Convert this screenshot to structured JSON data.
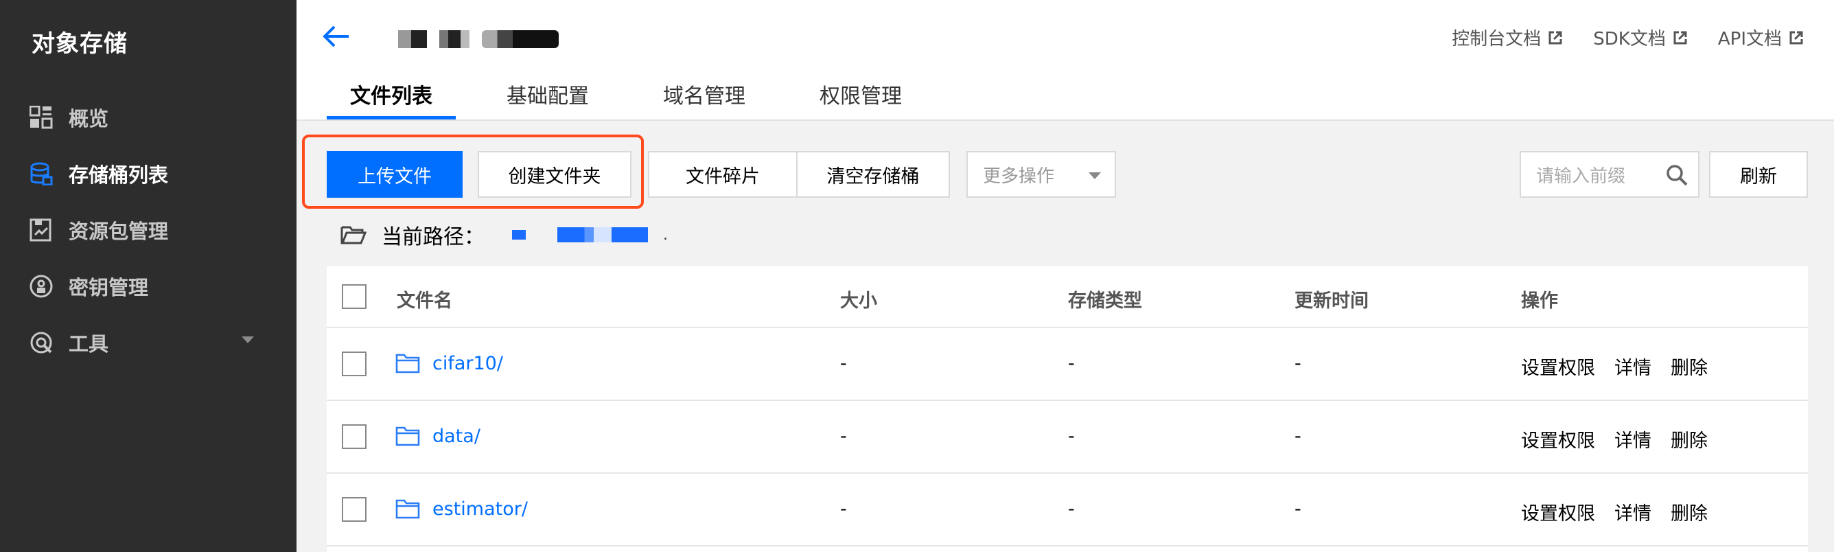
{
  "sidebar": {
    "title": "对象存储",
    "items": [
      {
        "label": "概览",
        "icon": "overview-grid-icon",
        "active": false
      },
      {
        "label": "存储桶列表",
        "icon": "bucket-list-icon",
        "active": true
      },
      {
        "label": "资源包管理",
        "icon": "resource-package-icon",
        "active": false
      },
      {
        "label": "密钥管理",
        "icon": "key-management-icon",
        "active": false
      },
      {
        "label": "工具",
        "icon": "tools-icon",
        "active": false
      }
    ]
  },
  "header": {
    "links": [
      {
        "label": "控制台文档"
      },
      {
        "label": "SDK文档"
      },
      {
        "label": "API文档"
      }
    ],
    "tabs": [
      {
        "label": "文件列表",
        "active": true
      },
      {
        "label": "基础配置",
        "active": false
      },
      {
        "label": "域名管理",
        "active": false
      },
      {
        "label": "权限管理",
        "active": false
      }
    ]
  },
  "toolbar": {
    "upload": "上传文件",
    "create_folder": "创建文件夹",
    "fragments": "文件碎片",
    "clear_bucket": "清空存储桶",
    "more_actions": "更多操作",
    "search_placeholder": "请输入前缀",
    "refresh": "刷新"
  },
  "path": {
    "label": "当前路径：",
    "suffix": "."
  },
  "table": {
    "columns": [
      "文件名",
      "大小",
      "存储类型",
      "更新时间",
      "操作"
    ],
    "rows": [
      {
        "name": "cifar10/",
        "size": "-",
        "storage_class": "-",
        "updated": "-"
      },
      {
        "name": "data/",
        "size": "-",
        "storage_class": "-",
        "updated": "-"
      },
      {
        "name": "estimator/",
        "size": "-",
        "storage_class": "-",
        "updated": "-"
      }
    ],
    "actions": [
      "设置权限",
      "详情",
      "删除"
    ]
  },
  "colors": {
    "accent": "#006eff",
    "sidebar_bg": "#2d2d2d",
    "highlight": "#ff4a1c"
  }
}
